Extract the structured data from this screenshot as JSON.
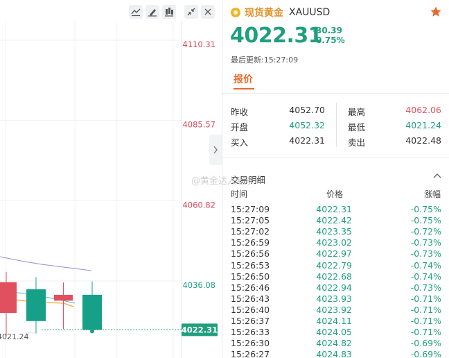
{
  "toolbar": {
    "icons": [
      "line-tool-icon",
      "brush-icon",
      "indicator-icon",
      "collapse-icon",
      "close-icon"
    ]
  },
  "chart_data": {
    "type": "candlestick",
    "y_ticks": [
      "4110.31",
      "4085.57",
      "4060.82",
      "4036.08"
    ],
    "current_price_label": "4022.31",
    "low_annotation": "4021.24",
    "ylim": [
      4010,
      4120
    ],
    "candles": [
      {
        "open": 4037.0,
        "high": 4040.2,
        "low": 4020.4,
        "close": 4027.5,
        "color": "red"
      },
      {
        "open": 4034.8,
        "high": 4038.6,
        "low": 4021.2,
        "close": 4025.0,
        "color": "teal"
      },
      {
        "open": 4033.3,
        "high": 4036.3,
        "low": 4023.0,
        "close": 4025.5,
        "color": "red"
      },
      {
        "open": 4033.1,
        "high": 4036.9,
        "low": 4022.5,
        "close": 4031.3,
        "color": "red"
      },
      {
        "open": 4033.1,
        "high": 4037.2,
        "low": 4022.3,
        "close": 4022.3,
        "color": "teal"
      }
    ],
    "colors": {
      "up": "#e0505e",
      "down": "#17a088",
      "ma_long": "#9b89d4",
      "ma_mid": "#f0a830",
      "ma_short": "#5ab3d6"
    }
  },
  "panel": {
    "symbol_name": "现货黄金",
    "symbol_code": "XAUUSD",
    "price": "4022.31",
    "change_abs": "-30.39",
    "change_pct": "-0.75%",
    "last_update_label": "最后更新:",
    "last_update_time": "15:27:09",
    "tab_label": "报价"
  },
  "quote": {
    "prev_close_label": "昨收",
    "prev_close": "4052.70",
    "open_label": "开盘",
    "open": "4052.32",
    "bid_label": "买入",
    "bid": "4022.31",
    "high_label": "最高",
    "high": "4062.06",
    "low_label": "最低",
    "low": "4021.24",
    "ask_label": "卖出",
    "ask": "4022.48"
  },
  "trades": {
    "title": "交易明细",
    "headers": {
      "time": "时间",
      "price": "价格",
      "change": "涨幅"
    },
    "rows": [
      {
        "time": "15:27:09",
        "price": "4022.31",
        "change": "-0.75%"
      },
      {
        "time": "15:27:05",
        "price": "4022.42",
        "change": "-0.75%"
      },
      {
        "time": "15:27:02",
        "price": "4023.35",
        "change": "-0.72%"
      },
      {
        "time": "15:26:59",
        "price": "4023.02",
        "change": "-0.73%"
      },
      {
        "time": "15:26:56",
        "price": "4022.97",
        "change": "-0.73%"
      },
      {
        "time": "15:26:53",
        "price": "4022.79",
        "change": "-0.74%"
      },
      {
        "time": "15:26:50",
        "price": "4022.68",
        "change": "-0.74%"
      },
      {
        "time": "15:26:46",
        "price": "4022.94",
        "change": "-0.73%"
      },
      {
        "time": "15:26:43",
        "price": "4023.93",
        "change": "-0.71%"
      },
      {
        "time": "15:26:40",
        "price": "4023.92",
        "change": "-0.71%"
      },
      {
        "time": "15:26:37",
        "price": "4024.11",
        "change": "-0.71%"
      },
      {
        "time": "15:26:33",
        "price": "4024.05",
        "change": "-0.71%"
      },
      {
        "time": "15:26:30",
        "price": "4024.82",
        "change": "-0.69%"
      },
      {
        "time": "15:26:27",
        "price": "4024.83",
        "change": "-0.69%"
      }
    ]
  },
  "watermark": "@黄金达人老李",
  "colors": {
    "accent": "#e8692a",
    "down": "#1f9f7e",
    "up": "#e0505e",
    "gold": "#e0922a"
  }
}
